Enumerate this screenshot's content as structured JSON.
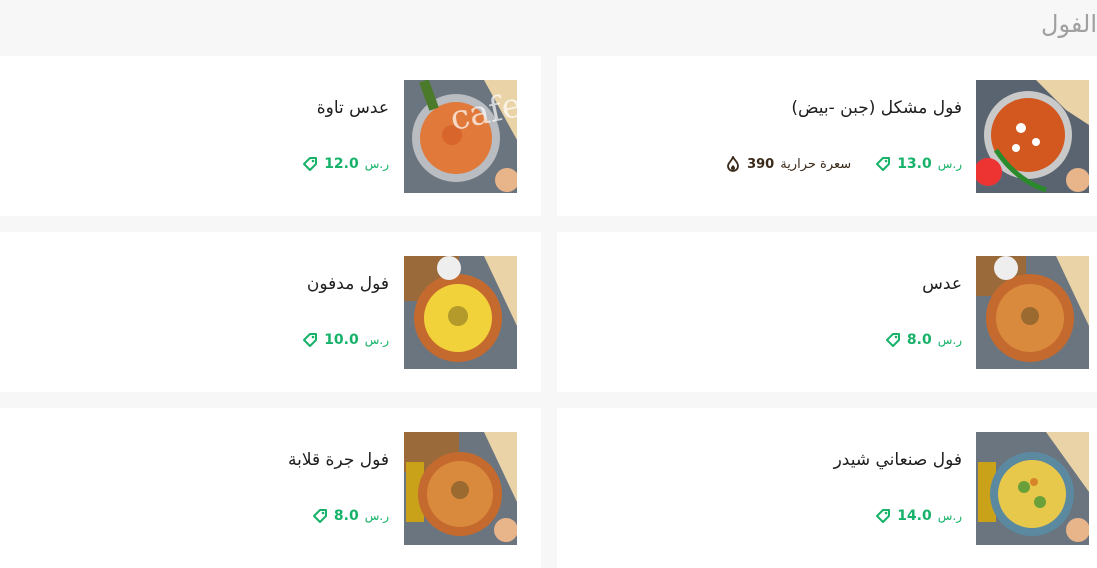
{
  "section": {
    "title": "الفول"
  },
  "watermark": "cafe",
  "items": [
    {
      "name": "فول مشكل (جبن -بيض)",
      "price": "13.0",
      "currency": "ر.س",
      "calories": "390",
      "calories_unit": "سعرة حرارية",
      "dish": "beans-tomato"
    },
    {
      "name": "عدس تاوة",
      "price": "12.0",
      "currency": "ر.س",
      "dish": "lentil-pan"
    },
    {
      "name": "عدس",
      "price": "8.0",
      "currency": "ر.س",
      "dish": "lentil-bowl"
    },
    {
      "name": "فول مدفون",
      "price": "10.0",
      "currency": "ر.س",
      "dish": "tahini-bowl"
    },
    {
      "name": "فول صنعاني شيدر",
      "price": "14.0",
      "currency": "ر.س",
      "dish": "cheddar-beans"
    },
    {
      "name": "فول جرة قلابة",
      "price": "8.0",
      "currency": "ر.س",
      "dish": "beans-bowl"
    }
  ],
  "colors": {
    "price": "#17b26a",
    "title": "#a0a0a0"
  }
}
